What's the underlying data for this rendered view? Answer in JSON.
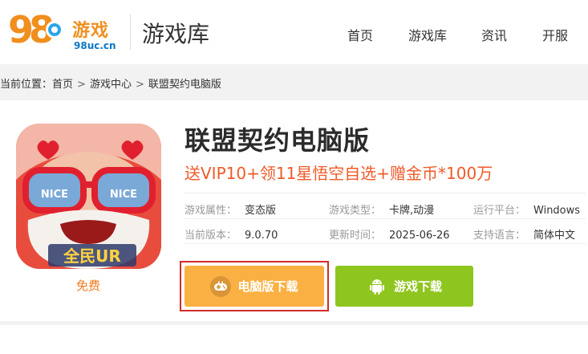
{
  "header": {
    "logo_number": "98",
    "logo_cn": "游戏",
    "logo_en": "98uc.cn",
    "section_title": "游戏库",
    "nav": [
      "首页",
      "游戏库",
      "资讯",
      "开服"
    ]
  },
  "breadcrumb": {
    "prefix": "当前位置：",
    "items": [
      "首页",
      "游戏中心",
      "联盟契约电脑版"
    ],
    "separator": ">"
  },
  "game": {
    "title": "联盟契约电脑版",
    "promo": "送VIP10+领11星悟空自选+赠金币*100万",
    "price_label": "免费",
    "icon_text": "全民UR",
    "info": [
      {
        "key": "游戏属性：",
        "value": "变态版"
      },
      {
        "key": "游戏类型：",
        "value": "卡牌,动漫"
      },
      {
        "key": "运行平台：",
        "value": "Windows"
      },
      {
        "key": "当前版本：",
        "value": "9.0.70"
      },
      {
        "key": "更新时间：",
        "value": "2025-06-26"
      },
      {
        "key": "支持语言：",
        "value": "简体中文"
      }
    ]
  },
  "buttons": {
    "pc_download": "电脑版下载",
    "game_download": "游戏下载"
  },
  "colors": {
    "accent_orange": "#f08f1e",
    "promo_red": "#f05a28",
    "pc_button": "#fbb043",
    "game_button": "#8fc51f",
    "highlight": "#d42b2b"
  },
  "icons": {
    "pc_button_icon": "gamepad-icon",
    "game_button_icon": "android-icon"
  }
}
